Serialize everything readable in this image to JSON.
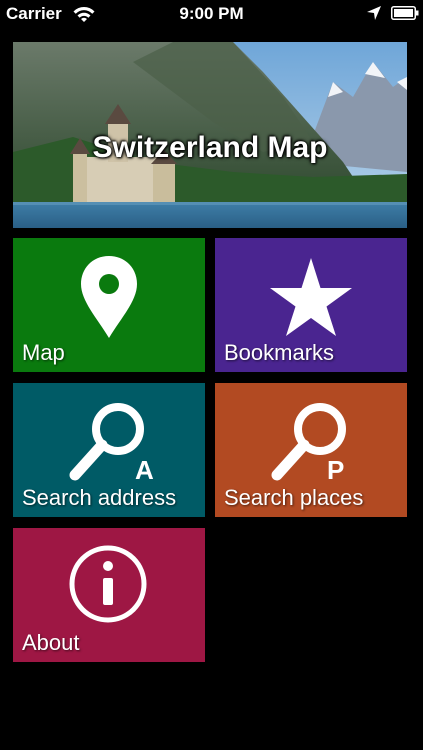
{
  "status_bar": {
    "carrier": "Carrier",
    "time": "9:00 PM",
    "icons": [
      "wifi-icon",
      "location-arrow-icon",
      "battery-icon"
    ]
  },
  "banner": {
    "title": "Switzerland Map"
  },
  "tiles": [
    {
      "label": "Map",
      "icon": "map-pin-icon",
      "color": "#0a7a0e"
    },
    {
      "label": "Bookmarks",
      "icon": "star-icon",
      "color": "#4a2590"
    },
    {
      "label": "Search address",
      "icon": "search-address-icon",
      "icon_letter": "A",
      "color": "#005b66"
    },
    {
      "label": "Search places",
      "icon": "search-places-icon",
      "icon_letter": "P",
      "color": "#b24a22"
    },
    {
      "label": "About",
      "icon": "info-icon",
      "color": "#9e1744"
    }
  ]
}
